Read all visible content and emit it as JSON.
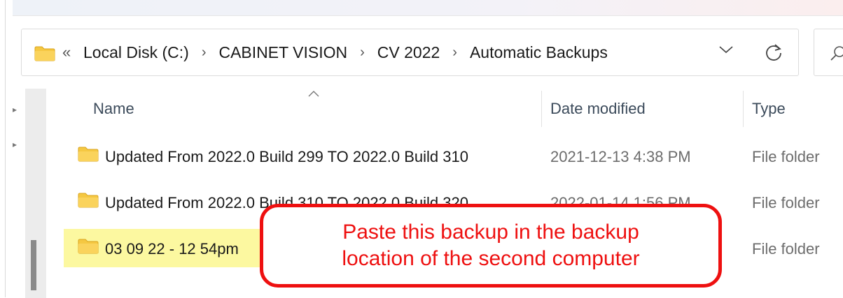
{
  "address": {
    "folder_icon": "folder-icon",
    "overflow": "«",
    "crumbs": [
      "Local Disk (C:)",
      "CABINET VISION",
      "CV 2022",
      "Automatic Backups"
    ],
    "separator": "›"
  },
  "columns": {
    "name": "Name",
    "date": "Date modified",
    "type": "Type"
  },
  "rows": [
    {
      "name": "Updated From 2022.0 Build 299 TO 2022.0 Build 310",
      "date": "2021-12-13 4:38 PM",
      "type": "File folder"
    },
    {
      "name": "Updated From 2022.0 Build 310 TO 2022.0 Build 320",
      "date": "2022-01-14 1:56 PM",
      "type": "File folder"
    },
    {
      "name": "03 09 22 - 12 54pm",
      "date": "",
      "type": "File folder"
    }
  ],
  "callout": {
    "line1": "Paste this backup in the backup",
    "line2": "location of the second computer"
  },
  "colors": {
    "folder": "#f5c842",
    "selection": "#fcf8a0",
    "callout": "#ee1010"
  }
}
